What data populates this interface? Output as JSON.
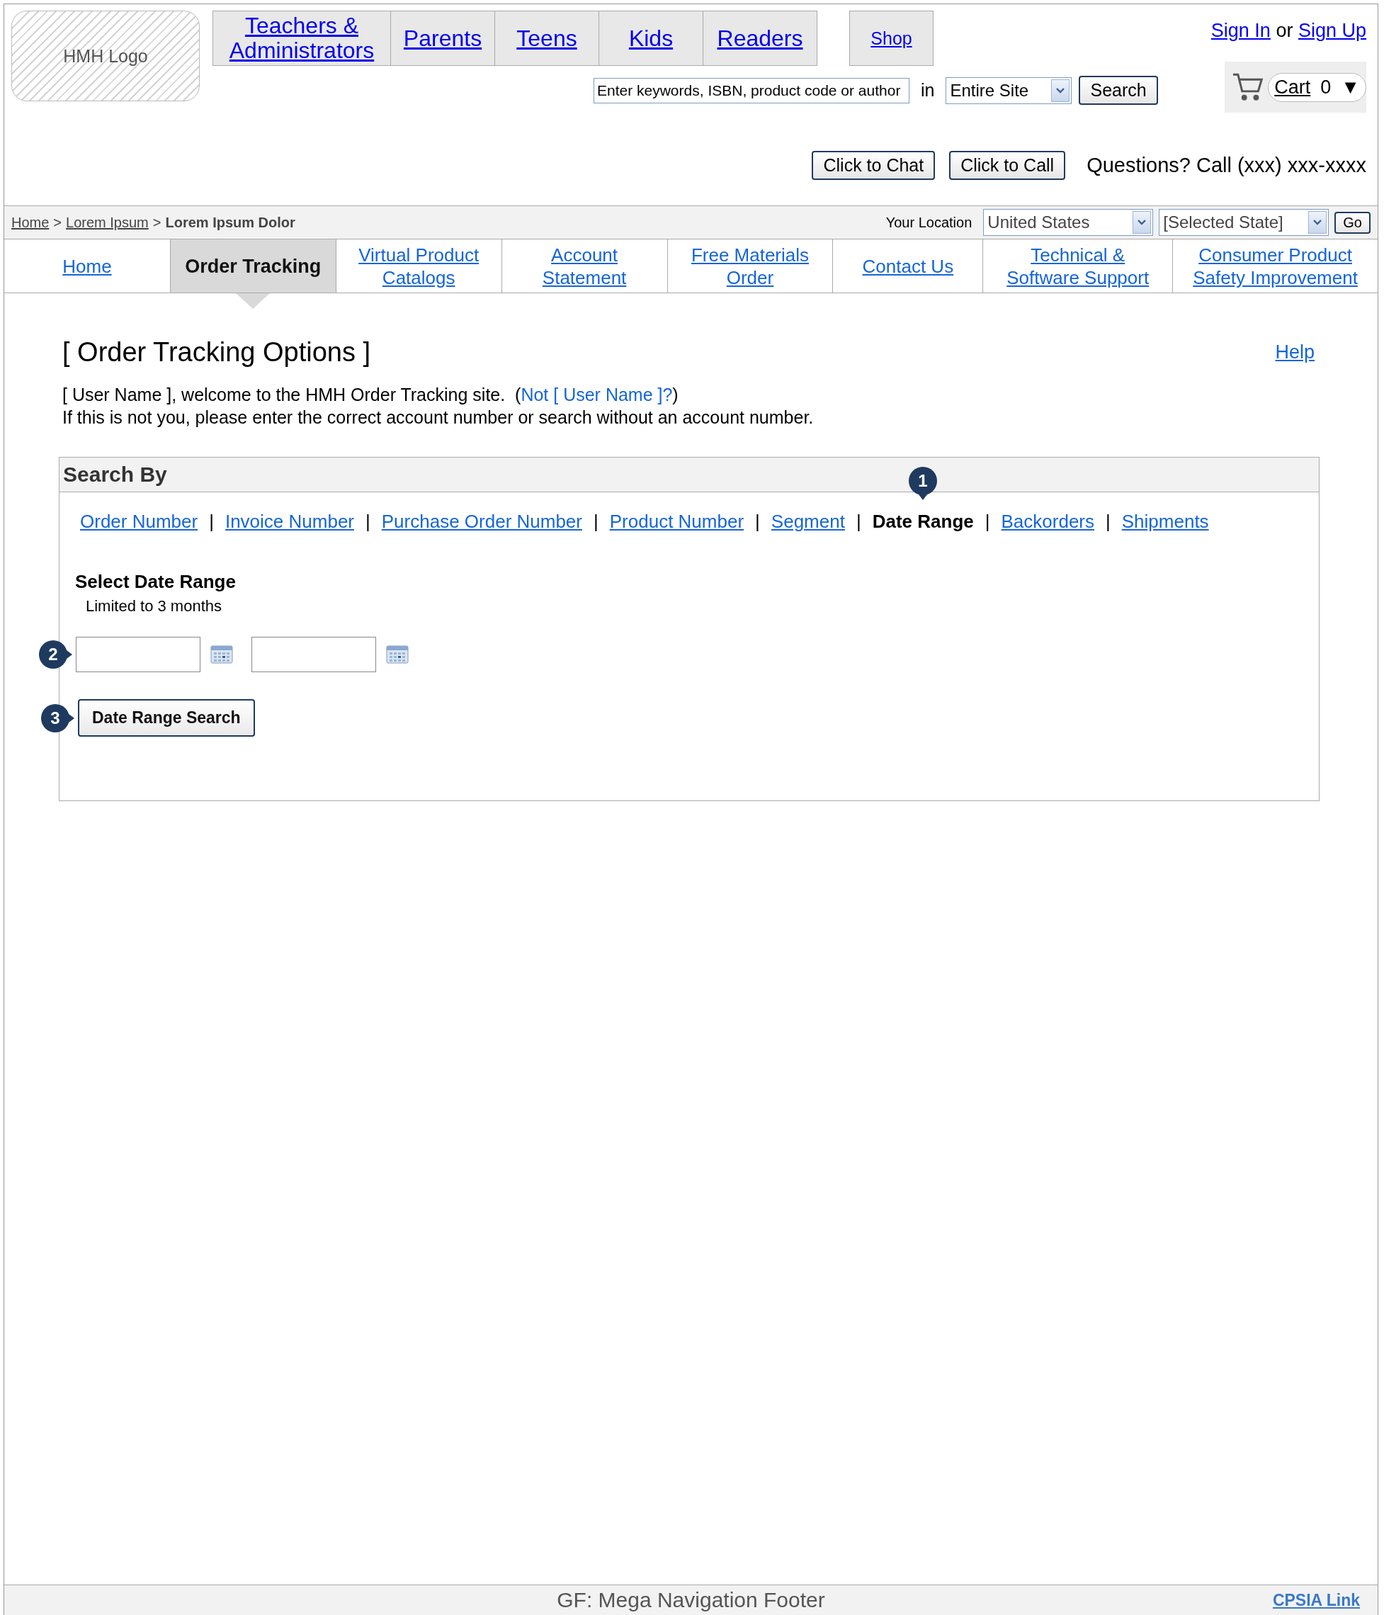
{
  "logo": {
    "text": "HMH Logo"
  },
  "top_nav": [
    {
      "label": "Teachers & Administrators",
      "kind": "audience"
    },
    {
      "label": "Parents",
      "kind": "audience"
    },
    {
      "label": "Teens",
      "kind": "audience"
    },
    {
      "label": "Kids",
      "kind": "audience"
    },
    {
      "label": "Readers",
      "kind": "audience"
    },
    {
      "label": "Shop",
      "kind": "shop"
    }
  ],
  "account": {
    "sign_in": "Sign In",
    "joiner": "or",
    "sign_up": "Sign Up"
  },
  "search": {
    "value": "Enter keywords, ISBN, product code or author",
    "joiner": "in",
    "scope": "Entire Site",
    "button": "Search"
  },
  "cart": {
    "label": "Cart",
    "count": "0",
    "caret": "▼"
  },
  "contact": {
    "buttons": [
      "Click to Chat",
      "Click to Call"
    ],
    "phone": "Questions? Call (xxx) xxx-xxxx"
  },
  "breadcrumb": {
    "separator": ">",
    "items": [
      {
        "label": "Home",
        "link": true
      },
      {
        "label": "Lorem Ipsum",
        "link": true
      },
      {
        "label": "Lorem Ipsum Dolor",
        "link": false
      }
    ]
  },
  "location": {
    "label": "Your Location",
    "country": "United States",
    "state": "[Selected State]",
    "button": "Go"
  },
  "main_nav": [
    {
      "label": "Home",
      "selected": false
    },
    {
      "label": "Order Tracking",
      "selected": true
    },
    {
      "label": "Virtual Product Catalogs",
      "selected": false
    },
    {
      "label": "Account Statement",
      "selected": false
    },
    {
      "label": "Free Materials Order",
      "selected": false
    },
    {
      "label": "Contact Us",
      "selected": false
    },
    {
      "label": "Technical & Software Support",
      "selected": false
    },
    {
      "label": "Consumer Product Safety Improvement",
      "selected": false
    }
  ],
  "page": {
    "title": "[ Order Tracking Options ]",
    "help": "Help",
    "welcome_before": "[ User Name ], welcome to the HMH Order Tracking site.  (",
    "welcome_link": "Not [ User Name ]?",
    "welcome_after": ")",
    "note": "If this is not you, please enter the correct account number or search without an account number."
  },
  "search_by": {
    "title": "Search By",
    "separator": "|",
    "options": [
      {
        "label": "Order Number",
        "selected": false
      },
      {
        "label": "Invoice Number",
        "selected": false
      },
      {
        "label": "Purchase Order Number",
        "selected": false
      },
      {
        "label": "Product Number",
        "selected": false
      },
      {
        "label": "Segment",
        "selected": false
      },
      {
        "label": "Date Range",
        "selected": true
      },
      {
        "label": "Backorders",
        "selected": false
      },
      {
        "label": "Shipments",
        "selected": false
      }
    ],
    "heading": "Select Date Range",
    "limit": "Limited to 3 months",
    "button": "Date Range Search",
    "callouts": {
      "options": "1",
      "dates": "2",
      "button": "3"
    }
  },
  "footer": {
    "text": "GF: Mega Navigation Footer",
    "link": "CPSIA Link"
  }
}
